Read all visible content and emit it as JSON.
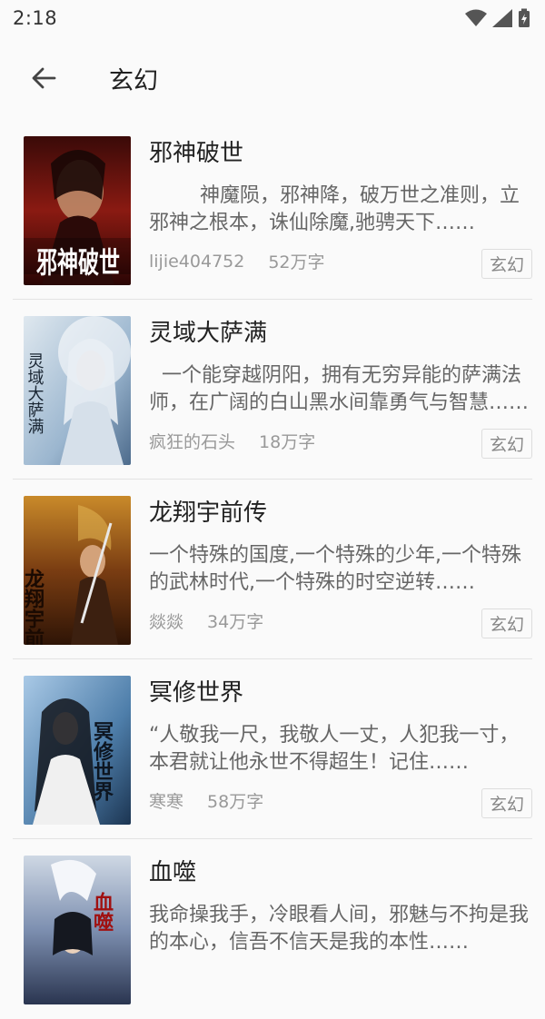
{
  "status": {
    "time": "2:18"
  },
  "header": {
    "title": "玄幻"
  },
  "books": [
    {
      "title": "邪神破世",
      "desc": "        神魔陨，邪神降，破万世之准则，立邪神之根本，诛仙除魔,驰骋天下……",
      "author": "lijie404752",
      "words": "52万字",
      "tag": "玄幻",
      "cover_text": "邪神破世"
    },
    {
      "title": "灵域大萨满",
      "desc": "  一个能穿越阴阳，拥有无穷异能的萨满法师，在广阔的白山黑水间靠勇气与智慧……",
      "author": "疯狂的石头",
      "words": "18万字",
      "tag": "玄幻",
      "cover_text": "灵域大萨满"
    },
    {
      "title": "龙翔宇前传",
      "desc": "一个特殊的国度,一个特殊的少年,一个特殊的武林时代,一个特殊的时空逆转……",
      "author": "燚燚",
      "words": "34万字",
      "tag": "玄幻",
      "cover_text": "龙翔宇前传"
    },
    {
      "title": "冥修世界",
      "desc": "“人敬我一尺，我敬人一丈，人犯我一寸，本君就让他永世不得超生！记住……",
      "author": "寒寒",
      "words": "58万字",
      "tag": "玄幻",
      "cover_text": "冥修世界"
    },
    {
      "title": "血噬",
      "desc": "我命操我手，冷眼看人间，邪魅与不拘是我的本心，信吾不信天是我的本性……",
      "author": "",
      "words": "",
      "tag": "",
      "cover_text": "血噬"
    }
  ]
}
